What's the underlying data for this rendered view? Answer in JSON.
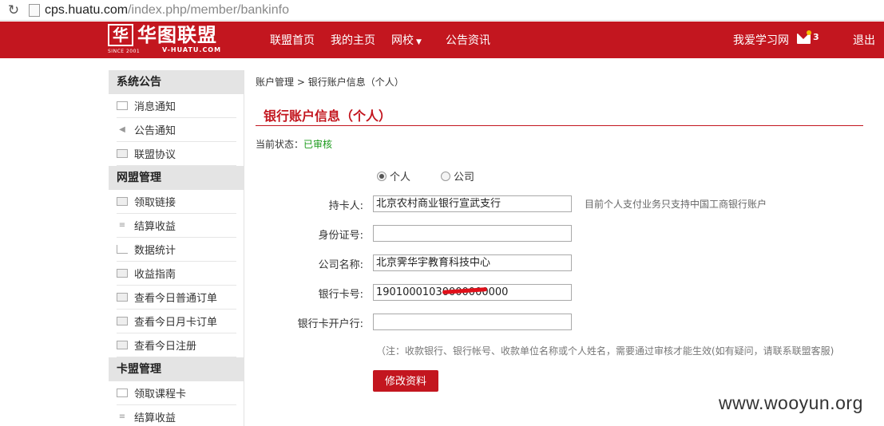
{
  "browser": {
    "url_host": "cps.huatu.com",
    "url_path": "/index.php/member/bankinfo"
  },
  "header": {
    "logo_mark": "华",
    "logo_text": "华图联盟",
    "logo_since": "SINCE 2001",
    "logo_sub": "V-HUATU.COM",
    "nav": [
      "联盟首页",
      "我的主页",
      "网校",
      "公告资讯"
    ],
    "site_link": "我爱学习网",
    "mail_count": "3",
    "logout": "退出",
    "brand_color": "#c3161f"
  },
  "sidebar": {
    "sections": [
      {
        "title": "系统公告",
        "items": [
          {
            "label": "消息通知",
            "icon": "mail-icon"
          },
          {
            "label": "公告通知",
            "icon": "speaker-icon"
          },
          {
            "label": "联盟协议",
            "icon": "document-icon"
          }
        ]
      },
      {
        "title": "网盟管理",
        "items": [
          {
            "label": "领取链接",
            "icon": "link-icon"
          },
          {
            "label": "结算收益",
            "icon": "coins-icon"
          },
          {
            "label": "数据统计",
            "icon": "chart-icon"
          },
          {
            "label": "收益指南",
            "icon": "box-icon"
          },
          {
            "label": "查看今日普通订单",
            "icon": "box-icon"
          },
          {
            "label": "查看今日月卡订单",
            "icon": "box-icon"
          },
          {
            "label": "查看今日注册",
            "icon": "box-icon"
          }
        ]
      },
      {
        "title": "卡盟管理",
        "items": [
          {
            "label": "领取课程卡",
            "icon": "card-icon"
          },
          {
            "label": "结算收益",
            "icon": "coins-icon"
          }
        ]
      }
    ]
  },
  "main": {
    "breadcrumb": [
      "账户管理",
      "银行账户信息（个人）"
    ],
    "breadcrumb_sep": ">",
    "title": "银行账户信息（个人）",
    "status_label": "当前状态：",
    "status_value": "已审核",
    "status_color": "#1a9a1a",
    "account_type": {
      "options": [
        "个人",
        "公司"
      ],
      "selected": "个人"
    },
    "form": {
      "holder_label": "持卡人:",
      "holder_value": "北京农村商业银行宣武支行",
      "holder_hint": "目前个人支付业务只支持中国工商银行账户",
      "idcard_label": "身份证号:",
      "idcard_value": "",
      "company_label": "公司名称:",
      "company_value": "北京霁华宇教育科技中心",
      "cardno_label": "银行卡号:",
      "cardno_value": "19010001030000000000",
      "bank_label": "银行卡开户行:",
      "bank_value": ""
    },
    "note": "（注：收款银行、银行帐号、收款单位名称或个人姓名，需要通过审核才能生效(如有疑问，请联系联盟客服)",
    "submit_label": "修改资料"
  },
  "watermark": "www.wooyun.org"
}
